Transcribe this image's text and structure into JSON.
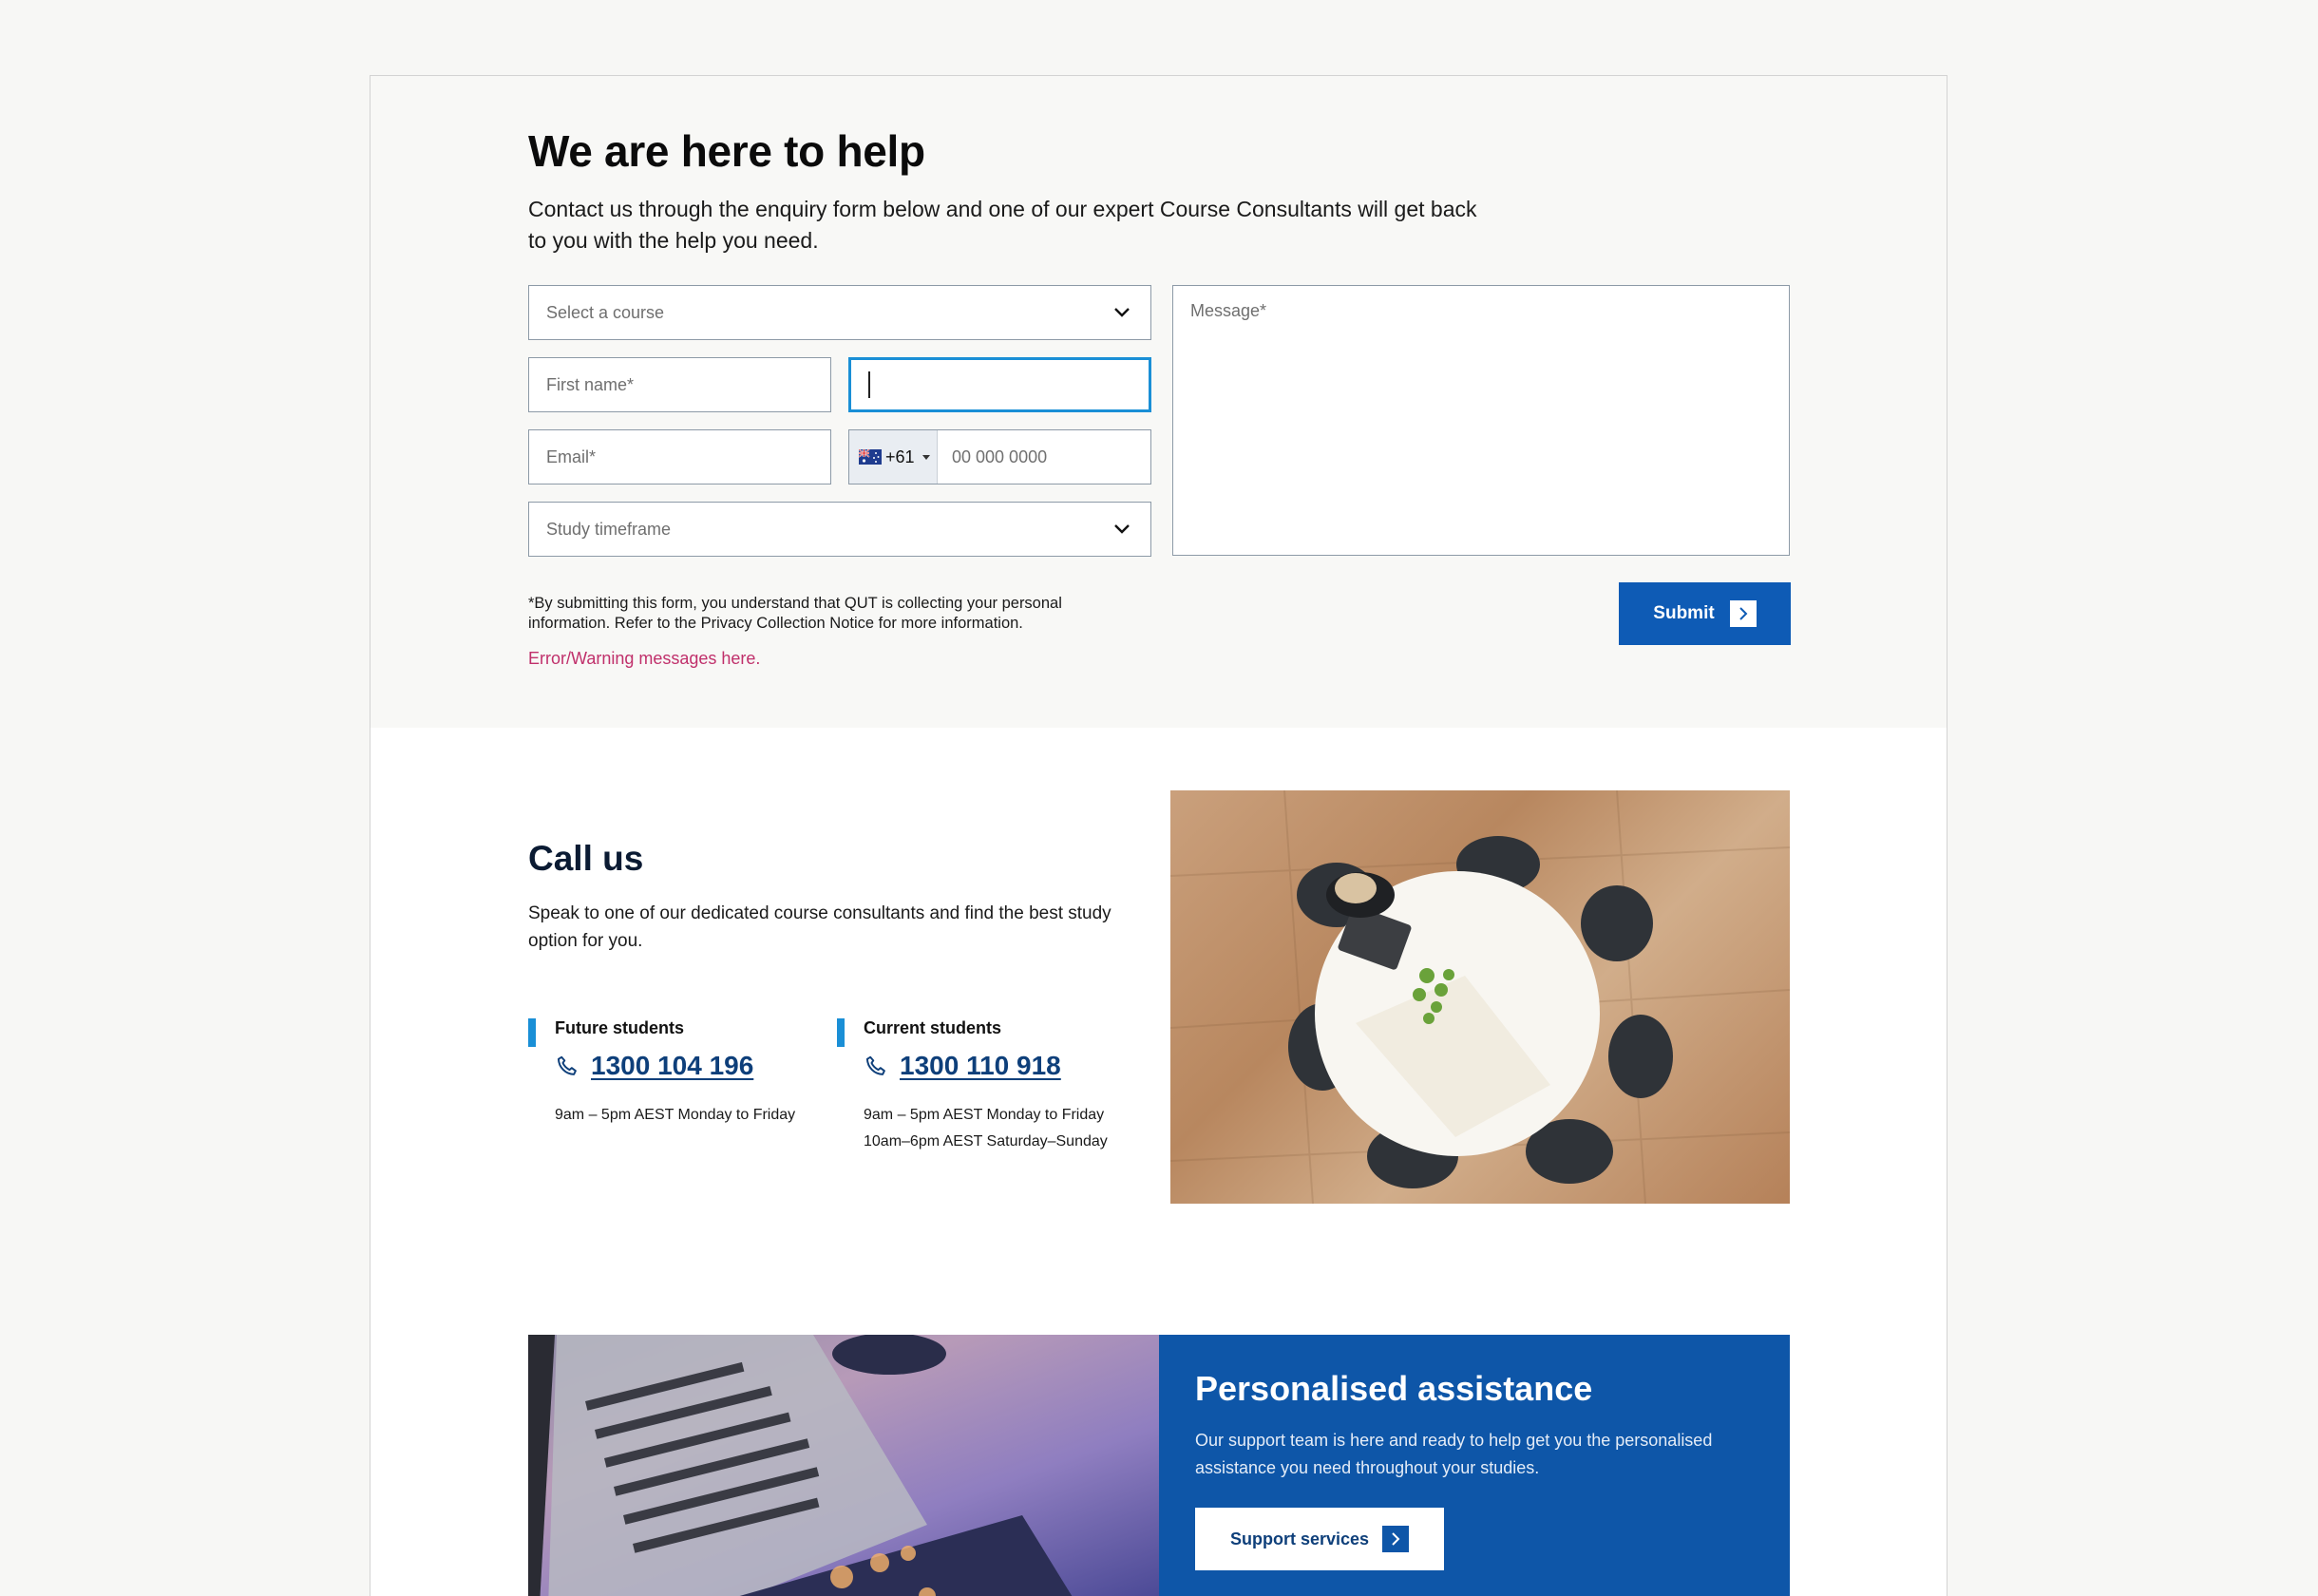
{
  "enquiry": {
    "title": "We are here to help",
    "intro": "Contact us through the enquiry form below and one of our expert Course Consultants will get back to you with the help you need.",
    "course_select": {
      "placeholder": "Select a course"
    },
    "first_name": {
      "placeholder": "First name*"
    },
    "last_name": {
      "value": ""
    },
    "email": {
      "placeholder": "Email*"
    },
    "phone": {
      "country_code": "+61",
      "country_flag": "australia-flag-icon",
      "placeholder": "00 000 0000"
    },
    "study_timeframe": {
      "placeholder": "Study timeframe"
    },
    "message": {
      "placeholder": "Message*"
    },
    "disclaimer": "*By submitting this form, you understand that QUT is collecting your personal information. Refer to the Privacy Collection Notice for more information.",
    "error": "Error/Warning messages here.",
    "submit_label": "Submit"
  },
  "call_us": {
    "title": "Call us",
    "description": "Speak to one of our dedicated course consultants and find the best study option for you.",
    "future": {
      "label": "Future students",
      "number": "1300 104 196",
      "hours": [
        "9am – 5pm AEST Monday to Friday"
      ]
    },
    "current": {
      "label": "Current students",
      "number": "1300 110 918",
      "hours": [
        "9am – 5pm AEST Monday to Friday",
        "10am–6pm AEST Saturday–Sunday"
      ]
    }
  },
  "assistance": {
    "title": "Personalised assistance",
    "description": "Our support team is here and ready to help get you the personalised assistance you need throughout your studies.",
    "button_label": "Support services"
  },
  "colors": {
    "primary_blue": "#0e5bb5",
    "accent_cyan": "#1a8fd6",
    "error_pink": "#c0306b",
    "panel_blue": "#0e56a8"
  }
}
